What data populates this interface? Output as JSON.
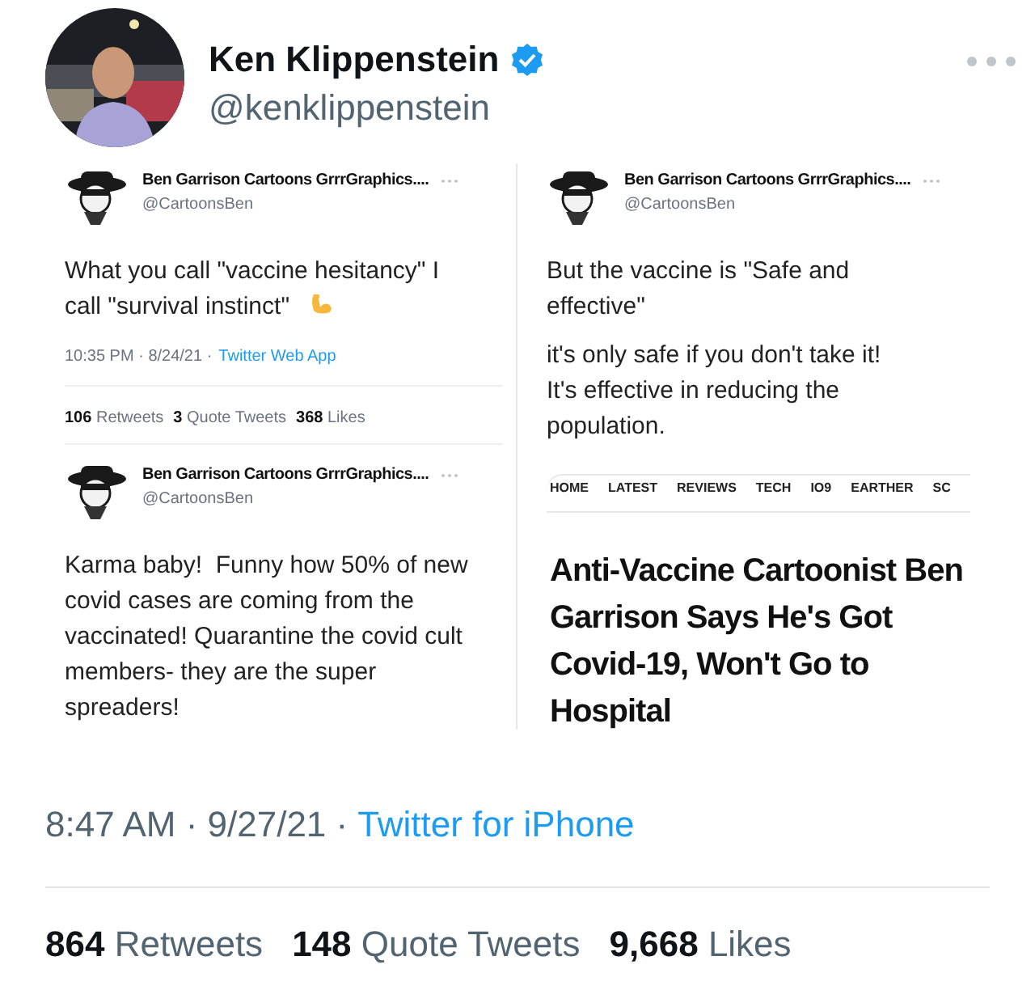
{
  "author": {
    "name": "Ken Klippenstein",
    "handle": "@kenklippenstein",
    "verified": true
  },
  "screenshot": {
    "left_column": [
      {
        "name": "Ben Garrison Cartoons GrrrGraphics....",
        "handle": "@CartoonsBen",
        "paragraphs": [
          "What you call \"vaccine hesitancy\" I call \"survival instinct\""
        ],
        "emoji": true,
        "meta": "10:35 PM · 8/24/21 ·",
        "source": "Twitter Web App",
        "stats": [
          {
            "count": "106",
            "label": "Retweets"
          },
          {
            "count": "3",
            "label": "Quote Tweets"
          },
          {
            "count": "368",
            "label": "Likes"
          }
        ]
      },
      {
        "name": "Ben Garrison Cartoons GrrrGraphics....",
        "handle": "@CartoonsBen",
        "paragraphs": [
          "Karma baby!  Funny how 50% of new covid cases are coming from the vaccinated! Quarantine the covid cult members- they are the super spreaders!"
        ]
      }
    ],
    "right_column": {
      "tweet": {
        "name": "Ben Garrison Cartoons GrrrGraphics....",
        "handle": "@CartoonsBen",
        "paragraphs": [
          "But the vaccine is \"Safe and effective\"",
          "it's only safe if you don't take it!",
          "It's effective in reducing the population."
        ]
      },
      "article": {
        "nav_items": [
          "HOME",
          "LATEST",
          "REVIEWS",
          "TECH",
          "IO9",
          "EARTHER",
          "SC"
        ],
        "headline": "Anti-Vaccine Cartoonist Ben Garrison Says He's Got Covid-19, Won't Go to Hospital"
      }
    }
  },
  "time": "8:47 AM · 9/27/21 ·",
  "source": "Twitter for iPhone",
  "stats": [
    {
      "count": "864",
      "label": "Retweets"
    },
    {
      "count": "148",
      "label": "Quote Tweets"
    },
    {
      "count": "9,668",
      "label": "Likes"
    }
  ]
}
